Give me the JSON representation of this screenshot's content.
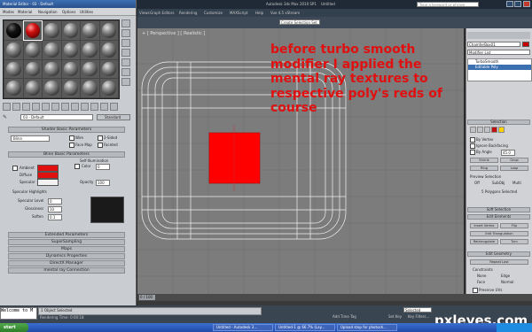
{
  "app": {
    "title": "Autodesk 3ds Max 2010 SP1",
    "doc": "Untitled",
    "search_placeholder": "Type a keyword or phrase",
    "menu": [
      "Views",
      "Graph Editors",
      "Rendering",
      "Customize",
      "MAXScript",
      "Help",
      "Vue 4.5 xStream"
    ],
    "selection_set": "Create Selection Set"
  },
  "material_editor": {
    "title": "Material Editor - 03 - Default",
    "menu": [
      "Modes",
      "Material",
      "Navigation",
      "Options",
      "Utilities"
    ],
    "material_name": "03 - Default",
    "material_type": "Standard",
    "rollouts": {
      "shader_basic": "Shader Basic Parameters",
      "blinn_basic": "Blinn Basic Parameters",
      "extended": "Extended Parameters",
      "supersampling": "SuperSampling",
      "maps": "Maps",
      "dynamics": "Dynamics Properties",
      "directx": "DirectX Manager",
      "mental_ray": "mental ray Connection"
    },
    "shader": "Blinn",
    "shader_options": [
      "Wire",
      "2-Sided",
      "Face Map",
      "Faceted"
    ],
    "self_illum_label": "Self-Illumination",
    "color_label": "Color",
    "color_value": "0",
    "ambient_label": "Ambient",
    "diffuse_label": "Diffuse",
    "specular_label": "Specular",
    "opacity_label": "Opacity",
    "opacity_value": "100",
    "spec_highlights": "Specular Highlights",
    "spec_level_label": "Specular Level",
    "spec_level_value": "0",
    "gloss_label": "Glossiness",
    "gloss_value": "10",
    "soften_label": "Soften",
    "soften_value": "0.1",
    "ambient_color": "#e01010",
    "diffuse_color": "#e01010",
    "specular_color": "#f2f2f2"
  },
  "viewport": {
    "label": "+ [ Perspective ] [ Realistic ]",
    "selected_face_color": "#ff0000",
    "note": "before turbo smooth modifier I applied the mental ray textures to respective poly's reds of course"
  },
  "command_panel": {
    "object_name": "ChamferBox01",
    "modifier_list": "Modifier List",
    "stack": [
      "TurboSmooth",
      "Editable Poly"
    ],
    "selection_head": "Selection",
    "by_vertex": "By Vertex",
    "ignore_backfacing": "Ignore Backfacing",
    "by_angle": "By Angle",
    "by_angle_value": "45.0",
    "shrink": "Shrink",
    "grow": "Grow",
    "ring": "Ring",
    "loop": "Loop",
    "preview_selection": "Preview Selection",
    "preview_options": [
      "Off",
      "SubObj",
      "Multi"
    ],
    "selected_info": "5 Polygons Selected",
    "soft_selection": "Soft Selection",
    "edit_elements": "Edit Elements",
    "insert_vertex": "Insert Vertex",
    "flip": "Flip",
    "edit_triangulation": "Edit Triangulation",
    "retriangulate": "Retriangulate",
    "turn": "Turn",
    "edit_geometry": "Edit Geometry",
    "repeat_last": "Repeat Last",
    "constraints": "Constraints",
    "constraint_options": [
      "None",
      "Edge",
      "Face",
      "Normal"
    ],
    "preserve_uvs": "Preserve UVs"
  },
  "status": {
    "maxscript": "Welcome to M",
    "objects_selected": "1 Object Selected",
    "render_time": "Rendering Time: 0:00:18",
    "frame": "0 / 100",
    "selected_dropdown": "Selected",
    "add_time_tag": "Add Time Tag",
    "set_key": "Set Key",
    "key_filters": "Key Filters...",
    "watermark": "pxleyes.com"
  },
  "taskbar": {
    "start": "start",
    "tasks": [
      "Untitled - Autodesk 3...",
      "Untitled-1 @ 66.7% (Lay...",
      "Upload step for photosh..."
    ]
  }
}
